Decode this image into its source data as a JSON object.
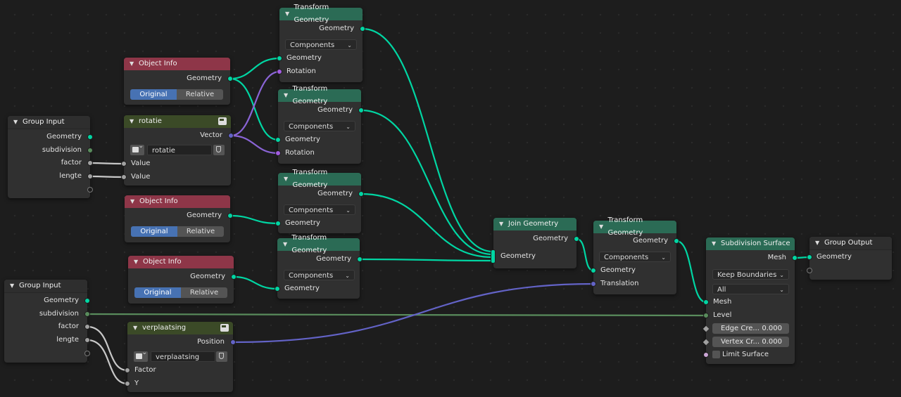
{
  "group_input_1": {
    "title": "Group Input",
    "outputs": [
      "Geometry",
      "subdivision",
      "factor",
      "lengte"
    ]
  },
  "group_input_2": {
    "title": "Group Input",
    "outputs": [
      "Geometry",
      "subdivision",
      "factor",
      "lengte"
    ]
  },
  "object_info_1": {
    "title": "Object Info",
    "output": "Geometry",
    "options": [
      "Original",
      "Relative"
    ],
    "selected": "Original"
  },
  "object_info_2": {
    "title": "Object Info",
    "output": "Geometry",
    "options": [
      "Original",
      "Relative"
    ],
    "selected": "Original"
  },
  "object_info_3": {
    "title": "Object Info",
    "output": "Geometry",
    "options": [
      "Original",
      "Relative"
    ],
    "selected": "Original"
  },
  "rotatie": {
    "title": "rotatie",
    "output": "Vector",
    "attribute": "rotatie",
    "inputs": [
      "Value",
      "Value"
    ]
  },
  "verplaatsing": {
    "title": "verplaatsing",
    "output": "Position",
    "attribute": "verplaatsing",
    "inputs": [
      "Factor",
      "Y"
    ]
  },
  "transform_1": {
    "title": "Transform Geometry",
    "output": "Geometry",
    "mode": "Components",
    "inputs": [
      "Geometry",
      "Rotation"
    ]
  },
  "transform_2": {
    "title": "Transform Geometry",
    "output": "Geometry",
    "mode": "Components",
    "inputs": [
      "Geometry",
      "Rotation"
    ]
  },
  "transform_3": {
    "title": "Transform Geometry",
    "output": "Geometry",
    "mode": "Components",
    "inputs": [
      "Geometry"
    ]
  },
  "transform_4": {
    "title": "Transform Geometry",
    "output": "Geometry",
    "mode": "Components",
    "inputs": [
      "Geometry"
    ]
  },
  "join": {
    "title": "Join Geometry",
    "output": "Geometry",
    "input": "Geometry"
  },
  "transform_5": {
    "title": "Transform Geometry",
    "output": "Geometry",
    "mode": "Components",
    "inputs": [
      "Geometry",
      "Translation"
    ]
  },
  "subdivision": {
    "title": "Subdivision Surface",
    "output": "Mesh",
    "boundary": "Keep Boundaries",
    "uv_smooth": "All",
    "inputs": [
      "Mesh",
      "Level"
    ],
    "edge_crease": {
      "label": "Edge Cre...",
      "value": "0.000"
    },
    "vertex_crease": {
      "label": "Vertex Cr...",
      "value": "0.000"
    },
    "limit_surface": "Limit Surface"
  },
  "group_output": {
    "title": "Group Output",
    "input": "Geometry"
  },
  "colors": {
    "geometry": "#00d6a3",
    "vector": "#6363c7",
    "rotation": "#a25be0",
    "float": "#a1a1a1",
    "integer": "#598c5c",
    "geometry_header": "#2b6b55",
    "object_header": "#8e3648",
    "attribute_header": "#3b4a27"
  }
}
